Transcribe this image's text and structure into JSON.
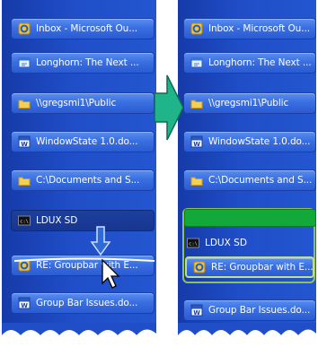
{
  "left_panel": {
    "items": [
      {
        "label": "Inbox - Microsoft Ou...",
        "icon": "outlook-icon"
      },
      {
        "label": "Longhorn: The Next ...",
        "icon": "browser-icon"
      },
      {
        "label": "\\\\gregsmi1\\Public",
        "icon": "folder-icon"
      },
      {
        "label": "WindowState 1.0.do...",
        "icon": "word-icon"
      },
      {
        "label": "C:\\Documents and S...",
        "icon": "folder-icon"
      },
      {
        "label": "LDUX SD",
        "icon": "console-icon"
      },
      {
        "label": "RE: Groupbar with E...",
        "icon": "outlook-icon"
      },
      {
        "label": "Group Bar Issues.do...",
        "icon": "word-icon"
      }
    ]
  },
  "right_panel": {
    "items": [
      {
        "label": "Inbox - Microsoft Ou...",
        "icon": "outlook-icon"
      },
      {
        "label": "Longhorn: The Next ...",
        "icon": "browser-icon"
      },
      {
        "label": "\\\\gregsmi1\\Public",
        "icon": "folder-icon"
      },
      {
        "label": "WindowState 1.0.do...",
        "icon": "word-icon"
      },
      {
        "label": "C:\\Documents and S...",
        "icon": "folder-icon"
      },
      {
        "label": "LDUX SD",
        "icon": "console-icon"
      },
      {
        "label": "RE: Groupbar with E...",
        "icon": "outlook-icon"
      },
      {
        "label": "Group Bar Issues.do...",
        "icon": "word-icon"
      }
    ]
  },
  "colors": {
    "panel": "#1f4ec8",
    "button": "#3a6fe1",
    "dragging_button": "#17368e",
    "group_slot": "#12a83a",
    "group_outline": "#8cc25a",
    "arrow": "#1fb48a"
  }
}
